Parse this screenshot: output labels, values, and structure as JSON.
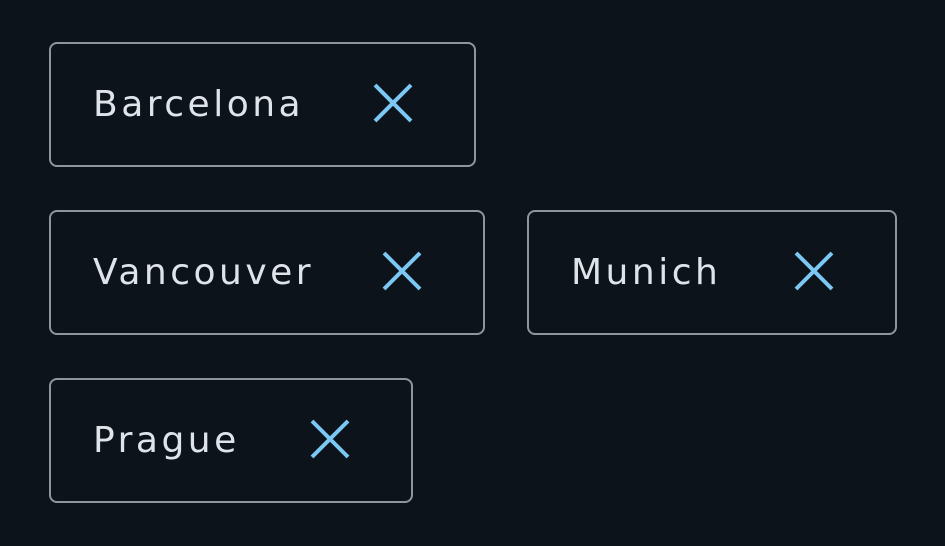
{
  "chips": [
    {
      "label": "Barcelona",
      "remove_icon": "close-icon"
    },
    {
      "label": "Vancouver",
      "remove_icon": "close-icon"
    },
    {
      "label": "Munich",
      "remove_icon": "close-icon"
    },
    {
      "label": "Prague",
      "remove_icon": "close-icon"
    }
  ],
  "colors": {
    "background": "#0d131a",
    "chip_border": "#8f959c",
    "label_text": "#dfe3ea",
    "remove_icon": "#7cc8f4"
  }
}
